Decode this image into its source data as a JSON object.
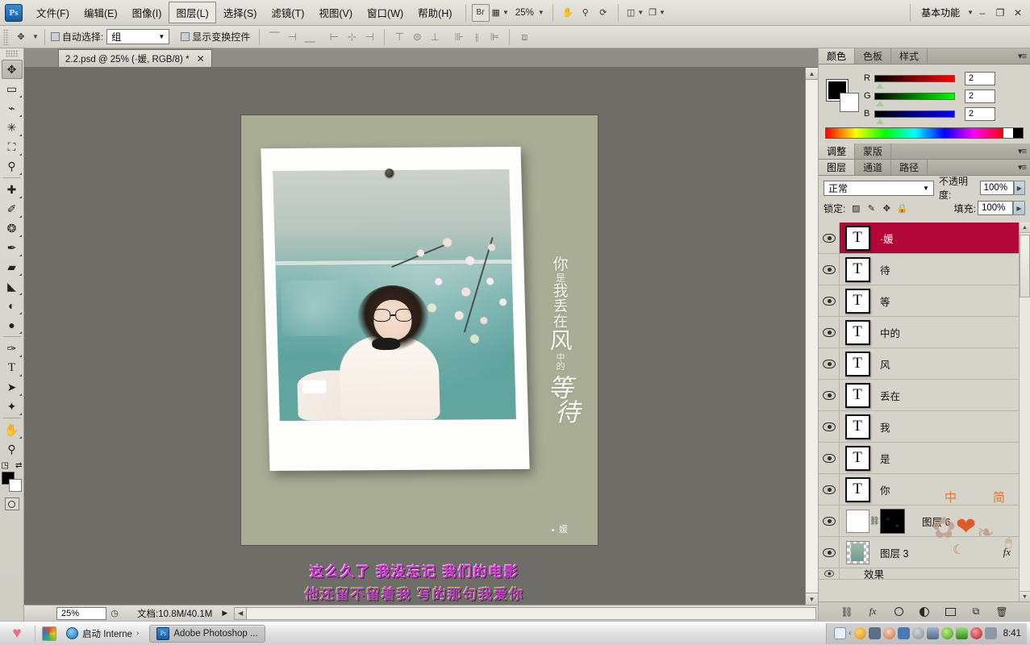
{
  "app": {
    "logo": "Ps",
    "menus": [
      {
        "label": "文件(F)",
        "active": false
      },
      {
        "label": "编辑(E)",
        "active": false
      },
      {
        "label": "图像(I)",
        "active": false
      },
      {
        "label": "图层(L)",
        "active": true
      },
      {
        "label": "选择(S)",
        "active": false
      },
      {
        "label": "滤镜(T)",
        "active": false
      },
      {
        "label": "视图(V)",
        "active": false
      },
      {
        "label": "窗口(W)",
        "active": false
      },
      {
        "label": "帮助(H)",
        "active": false
      }
    ],
    "bridge_label": "Br",
    "zoom_level": "25%",
    "workspace": "基本功能",
    "window_buttons": {
      "minimize": "–",
      "restore": "❐",
      "close": "✕"
    }
  },
  "options_bar": {
    "auto_select_label": "自动选择:",
    "auto_select_value": "组",
    "show_transform_label": "显示变换控件"
  },
  "document": {
    "tab_title": "2.2.psd @ 25% (·媛, RGB/8) *",
    "close_glyph": "✕"
  },
  "canvas": {
    "vertical_poem": [
      "你",
      "是",
      "我",
      "丢",
      "在",
      "风",
      "中",
      "的",
      "等",
      "待"
    ],
    "signature": "媛",
    "subtitle_line1": "这么久了  我没忘记  我们的电影",
    "subtitle_line2": "他还留不留着我 写的那句我爱你"
  },
  "status_bar": {
    "zoom": "25%",
    "doc_label": "文档:",
    "doc_size": "10.8M/40.1M",
    "play_glyph": "▶"
  },
  "panels": {
    "color_group": {
      "tabs": [
        {
          "label": "颜色",
          "active": true
        },
        {
          "label": "色板",
          "active": false
        },
        {
          "label": "样式",
          "active": false
        }
      ],
      "channels": [
        {
          "label": "R",
          "value": "2"
        },
        {
          "label": "G",
          "value": "2"
        },
        {
          "label": "B",
          "value": "2"
        }
      ],
      "foreground_color": "#000000",
      "background_color": "#ffffff"
    },
    "adjust_group": {
      "tabs": [
        {
          "label": "调整",
          "active": true
        },
        {
          "label": "蒙版",
          "active": false
        }
      ]
    },
    "layers_group": {
      "tabs": [
        {
          "label": "图层",
          "active": true
        },
        {
          "label": "通道",
          "active": false
        },
        {
          "label": "路径",
          "active": false
        }
      ],
      "blend_mode": "正常",
      "opacity_label": "不透明度:",
      "opacity_value": "100%",
      "lock_label": "锁定:",
      "fill_label": "填充:",
      "fill_value": "100%",
      "selected_color": "#b3073a",
      "layers": [
        {
          "name": "·媛",
          "type": "text",
          "selected": true,
          "visible": true
        },
        {
          "name": "待",
          "type": "text",
          "selected": false,
          "visible": true
        },
        {
          "name": "等",
          "type": "text",
          "selected": false,
          "visible": true
        },
        {
          "name": "中的",
          "type": "text",
          "selected": false,
          "visible": true
        },
        {
          "name": "风",
          "type": "text",
          "selected": false,
          "visible": true
        },
        {
          "name": "丢在",
          "type": "text",
          "selected": false,
          "visible": true
        },
        {
          "name": "我",
          "type": "text",
          "selected": false,
          "visible": true
        },
        {
          "name": "是",
          "type": "text",
          "selected": false,
          "visible": true
        },
        {
          "name": "你",
          "type": "text",
          "selected": false,
          "visible": true
        },
        {
          "name": "图层 6",
          "type": "masked",
          "selected": false,
          "visible": true
        },
        {
          "name": "图层 3",
          "type": "image",
          "selected": false,
          "visible": true,
          "fx": "fx"
        },
        {
          "name": "效果",
          "type": "effects",
          "selected": false,
          "visible": true
        }
      ],
      "footer_icons": [
        "link-icon",
        "fx-icon",
        "mask-icon",
        "adjustment-icon",
        "group-icon",
        "new-layer-icon",
        "delete-icon"
      ]
    }
  },
  "taskbar": {
    "start_label": "♥",
    "tasks": [
      {
        "label": "启动 Interne",
        "active": false,
        "icon": "ie-icon"
      },
      {
        "label": "Adobe Photoshop ...",
        "active": true,
        "icon": "ps-icon"
      }
    ],
    "clock": "8:41"
  },
  "tools": [
    {
      "name": "move-tool",
      "glyph": "✥",
      "selected": true,
      "sub": false
    },
    {
      "name": "marquee-tool",
      "glyph": "▭",
      "selected": false,
      "sub": true
    },
    {
      "name": "lasso-tool",
      "glyph": "✎",
      "selected": false,
      "sub": true
    },
    {
      "name": "magic-wand-tool",
      "glyph": "✳",
      "selected": false,
      "sub": true
    },
    {
      "name": "crop-tool",
      "glyph": "⛶",
      "selected": false,
      "sub": true
    },
    {
      "name": "eyedropper-tool",
      "glyph": "⚲",
      "selected": false,
      "sub": true
    },
    {
      "name": "healing-brush-tool",
      "glyph": "✚",
      "selected": false,
      "sub": true
    },
    {
      "name": "brush-tool",
      "glyph": "✐",
      "selected": false,
      "sub": true
    },
    {
      "name": "clone-stamp-tool",
      "glyph": "❂",
      "selected": false,
      "sub": true
    },
    {
      "name": "history-brush-tool",
      "glyph": "✒",
      "selected": false,
      "sub": true
    },
    {
      "name": "eraser-tool",
      "glyph": "▰",
      "selected": false,
      "sub": true
    },
    {
      "name": "gradient-tool",
      "glyph": "◧",
      "selected": false,
      "sub": true
    },
    {
      "name": "blur-tool",
      "glyph": "◐",
      "selected": false,
      "sub": true
    },
    {
      "name": "dodge-tool",
      "glyph": "●",
      "selected": false,
      "sub": true
    },
    {
      "name": "pen-tool",
      "glyph": "✑",
      "selected": false,
      "sub": true
    },
    {
      "name": "type-tool",
      "glyph": "T",
      "selected": false,
      "sub": true
    },
    {
      "name": "path-selection-tool",
      "glyph": "➤",
      "selected": false,
      "sub": true
    },
    {
      "name": "shape-tool",
      "glyph": "✦",
      "selected": false,
      "sub": true
    },
    {
      "name": "hand-tool",
      "glyph": "✋",
      "selected": false,
      "sub": true
    },
    {
      "name": "zoom-tool",
      "glyph": "🔍",
      "selected": false,
      "sub": false
    }
  ]
}
